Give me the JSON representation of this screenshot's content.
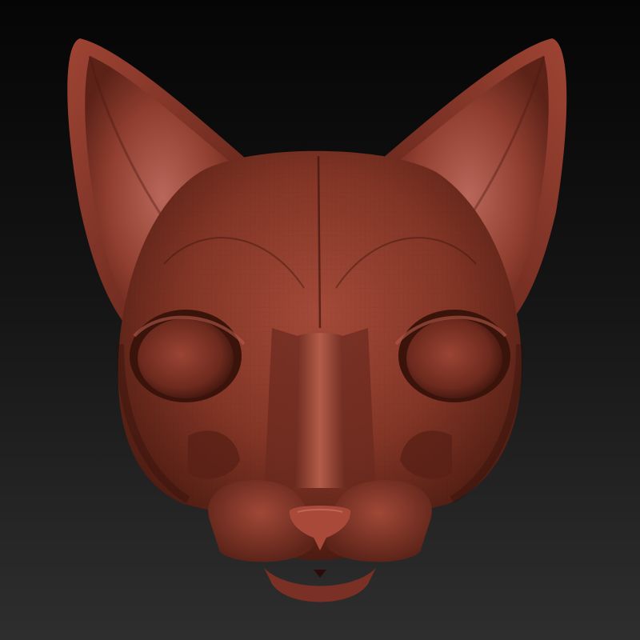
{
  "scene": {
    "subject": "cat-head-sculpt",
    "colors": {
      "background_top": "#050505",
      "background_bottom": "#2e2e2e",
      "clay_base": "#8a3a2c",
      "clay_light": "#b35a48",
      "clay_mid": "#7a3024",
      "clay_dark": "#4a1a12",
      "clay_shadow": "#2a0d08",
      "nose": "#a8493a"
    }
  }
}
